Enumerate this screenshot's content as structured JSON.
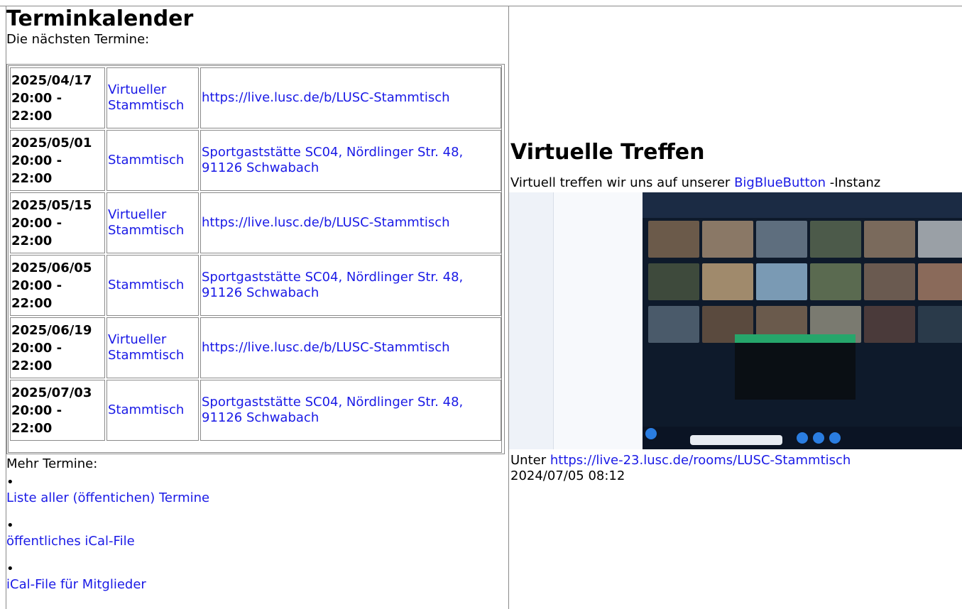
{
  "calendar": {
    "title": "Terminkalender",
    "intro": "Die nächsten Termine:",
    "events": [
      {
        "date": "2025/04/17",
        "time1": "20:00 -",
        "time2": "22:00",
        "type": "Virtueller Stammtisch",
        "location": "https://live.lusc.de/b/LUSC-Stammtisch"
      },
      {
        "date": "2025/05/01",
        "time1": "20:00 -",
        "time2": "22:00",
        "type": "Stammtisch",
        "location": "Sportgaststätte SC04, Nördlinger Str. 48, 91126 Schwabach"
      },
      {
        "date": "2025/05/15",
        "time1": "20:00 -",
        "time2": "22:00",
        "type": "Virtueller Stammtisch",
        "location": "https://live.lusc.de/b/LUSC-Stammtisch"
      },
      {
        "date": "2025/06/05",
        "time1": "20:00 -",
        "time2": "22:00",
        "type": "Stammtisch",
        "location": "Sportgaststätte SC04, Nördlinger Str. 48, 91126 Schwabach"
      },
      {
        "date": "2025/06/19",
        "time1": "20:00 -",
        "time2": "22:00",
        "type": "Virtueller Stammtisch",
        "location": "https://live.lusc.de/b/LUSC-Stammtisch"
      },
      {
        "date": "2025/07/03",
        "time1": "20:00 -",
        "time2": "22:00",
        "type": "Stammtisch",
        "location": "Sportgaststätte SC04, Nördlinger Str. 48, 91126 Schwabach"
      }
    ],
    "more_label": "Mehr Termine:",
    "bullet": "•",
    "links": [
      "Liste aller (öffentichen) Termine",
      "öffentliches iCal-File",
      "iCal-File für Mitglieder"
    ]
  },
  "virtual": {
    "title": "Virtuelle Treffen",
    "intro_before": "Virtuell treffen wir uns auf unserer",
    "intro_link": "BigBlueButton",
    "intro_after": "-Instanz",
    "under_prefix": "Unter",
    "under_link": "https://live-23.lusc.de/rooms/LUSC-Stammtisch",
    "timestamp": "2024/07/05 08:12"
  },
  "colors": {
    "link": "#1a1ae6",
    "border": "#8a8a8a"
  }
}
